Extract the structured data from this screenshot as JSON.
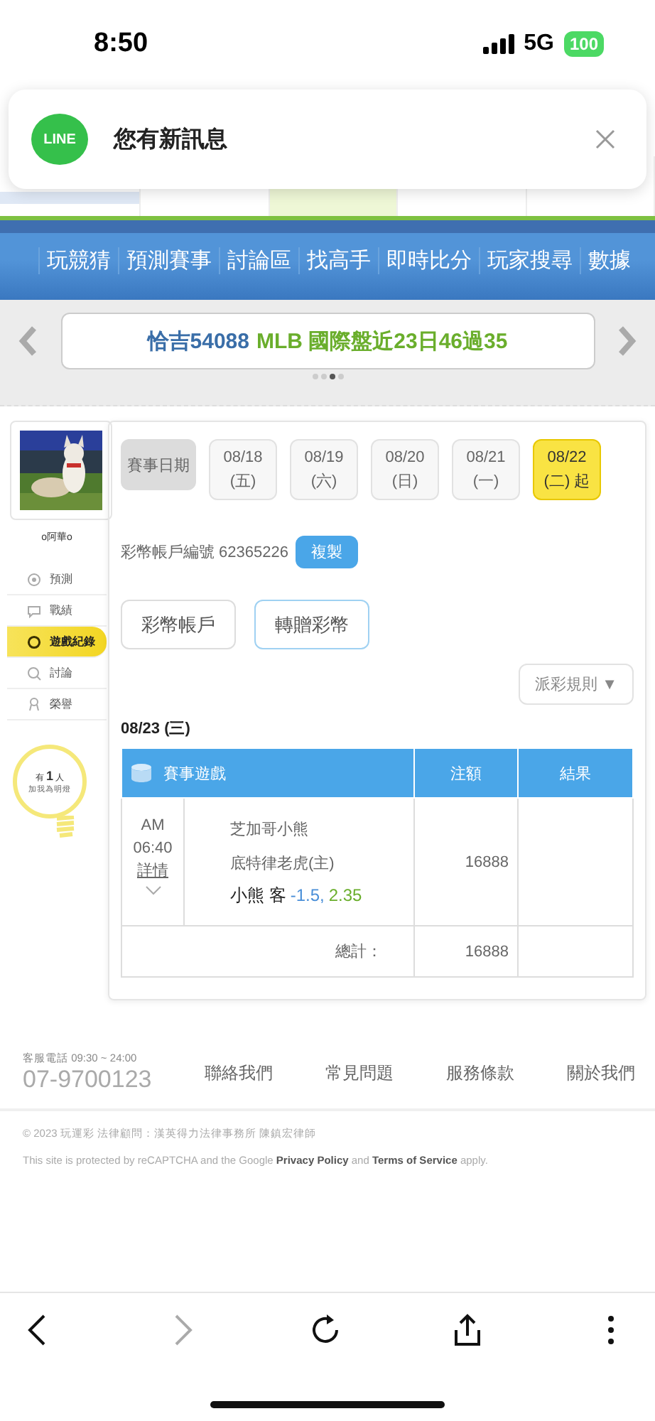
{
  "status_bar": {
    "time": "8:50",
    "network": "5G",
    "battery": "100"
  },
  "notification": {
    "app": "LINE",
    "message": "您有新訊息"
  },
  "header_tabs": [
    {
      "selected": false
    },
    {
      "selected": true
    },
    {
      "selected": false
    },
    {
      "selected": false
    }
  ],
  "nav_menu": [
    "玩競猜",
    "預測賽事",
    "討論區",
    "找高手",
    "即時比分",
    "玩家搜尋",
    "數據"
  ],
  "banner": {
    "tipster": "恰吉54088",
    "record": "MLB 國際盤近23日46過35",
    "dots": [
      {
        "selected": false
      },
      {
        "selected": false
      },
      {
        "selected": true
      },
      {
        "selected": false
      }
    ]
  },
  "sidebar": {
    "username": "o阿華o",
    "items": [
      {
        "label": "預測",
        "kind": "target",
        "selected": false
      },
      {
        "label": "戰績",
        "kind": "chat",
        "selected": false
      },
      {
        "label": "遊戲紀錄",
        "kind": "ring",
        "selected": true
      },
      {
        "label": "討論",
        "kind": "magnifier",
        "selected": false
      },
      {
        "label": "榮譽",
        "kind": "medal",
        "selected": false
      }
    ],
    "fans": {
      "prefix": "有",
      "count": "1",
      "suffix": "人",
      "caption": "加我為明燈"
    }
  },
  "dates": {
    "label": "賽事日期",
    "items": [
      {
        "date": "08/18",
        "weekday": "(五)",
        "selected": false
      },
      {
        "date": "08/19",
        "weekday": "(六)",
        "selected": false
      },
      {
        "date": "08/20",
        "weekday": "(日)",
        "selected": false
      },
      {
        "date": "08/21",
        "weekday": "(一)",
        "selected": false
      },
      {
        "date": "08/22",
        "weekday": "(二) 起",
        "selected": true
      }
    ]
  },
  "account": {
    "label": "彩幣帳戶編號 62365226",
    "copy_button": "複製"
  },
  "tabs": [
    {
      "label": "彩幣帳戶",
      "selected": false
    },
    {
      "label": "轉贈彩幣",
      "selected": true
    }
  ],
  "rules_dropdown": "派彩規則 ▼",
  "day": "08/23 (三)",
  "table": {
    "columns": [
      "賽事遊戲",
      "注額",
      "結果"
    ],
    "rows": [
      {
        "period": "AM",
        "time": "06:40",
        "details": "詳情",
        "away": "芝加哥小熊",
        "home": "底特律老虎(主)",
        "pick": "小熊 客",
        "line": "-1.5,",
        "odds": "2.35",
        "stake": "16888"
      }
    ],
    "total_label": "總計：",
    "total": "16888"
  },
  "footer": {
    "hotline": "客服電話 09:30 ~ 24:00",
    "phone": "07-9700123",
    "links": [
      "聯絡我們",
      "常見問題",
      "服務條款",
      "關於我們"
    ],
    "copyright": "© 2023 玩運彩 法律顧問：漢英得力法律事務所 陳鎮宏律師",
    "captcha": "This site is protected by reCAPTCHA and the Google **Privacy Policy** and **Terms of Service** apply."
  },
  "browser_toolbar": [
    {
      "kind": "back",
      "disabled": false
    },
    {
      "kind": "forward",
      "disabled": true
    },
    {
      "kind": "reload",
      "disabled": false
    },
    {
      "kind": "share",
      "disabled": false
    },
    {
      "kind": "more",
      "disabled": false
    }
  ]
}
